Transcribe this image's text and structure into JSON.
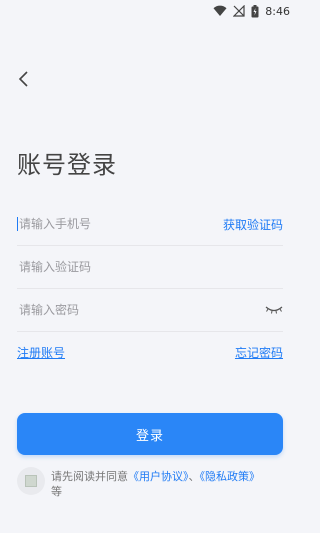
{
  "status_bar": {
    "time": "8:46"
  },
  "page": {
    "title": "账号登录"
  },
  "form": {
    "phone_placeholder": "请输入手机号",
    "get_code_label": "获取验证码",
    "code_placeholder": "请输入验证码",
    "password_placeholder": "请输入密码"
  },
  "links": {
    "register": "注册账号",
    "forgot": "忘记密码"
  },
  "login_button": "登录",
  "agreement": {
    "prefix": "请先阅读并同意",
    "user_agreement": "《用户协议》",
    "separator": "、",
    "privacy_policy": "《隐私政策》",
    "suffix": "等"
  },
  "colors": {
    "accent": "#2a86f7",
    "background": "#f4f5f9"
  },
  "icons": [
    "wifi-icon",
    "signal-icon",
    "battery-icon",
    "back-arrow-icon",
    "eye-closed-icon"
  ]
}
